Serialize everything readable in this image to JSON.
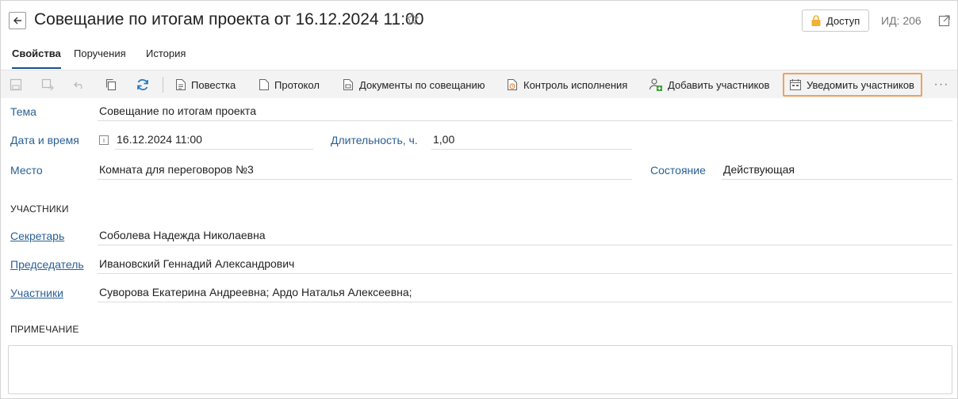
{
  "header": {
    "title": "Совещание по итогам проекта от 16.12.2024 11:00",
    "access_label": "Доступ",
    "id_label": "ИД: 206"
  },
  "tabs": [
    {
      "label": "Свойства",
      "active": true
    },
    {
      "label": "Поручения",
      "active": false
    },
    {
      "label": "История",
      "active": false
    }
  ],
  "toolbar": {
    "agenda": "Повестка",
    "protocol": "Протокол",
    "documents": "Документы по совещанию",
    "control": "Контроль исполнения",
    "add_participants": "Добавить участников",
    "notify_participants": "Уведомить участников",
    "more": "···"
  },
  "form": {
    "topic_label": "Тема",
    "topic_value": "Совещание по итогам проекта",
    "datetime_label": "Дата и время",
    "datetime_value": "16.12.2024 11:00",
    "duration_label": "Длительность, ч.",
    "duration_value": "1,00",
    "place_label": "Место",
    "place_value": "Комната для переговоров №3",
    "state_label": "Состояние",
    "state_value": "Действующая"
  },
  "participants": {
    "section_title": "УЧАСТНИКИ",
    "secretary_label": "Секретарь",
    "secretary_value": "Соболева Надежда Николаевна",
    "chairman_label": "Председатель",
    "chairman_value": "Ивановский Геннадий Александрович",
    "members_label": "Участники",
    "members_value": "Суворова Екатерина Андреевна; Ардо Наталья Алексеевна;"
  },
  "note": {
    "section_title": "ПРИМЕЧАНИЕ",
    "value": ""
  },
  "colors": {
    "accent": "#2a6096",
    "highlight_border": "#f0a15c",
    "toolbar_bg": "#f3f3f3",
    "refresh_icon": "#2b7bc4"
  }
}
